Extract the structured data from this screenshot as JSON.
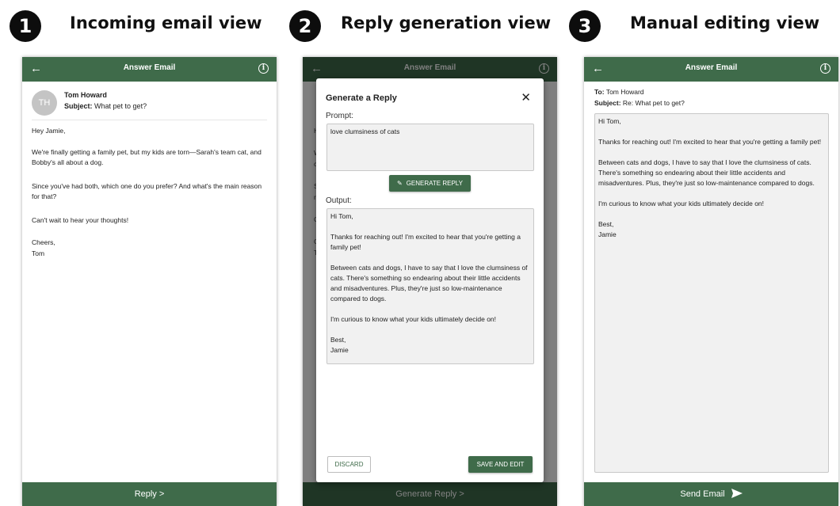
{
  "steps": [
    {
      "number": "1",
      "title": "Incoming email view"
    },
    {
      "number": "2",
      "title": "Reply generation view"
    },
    {
      "number": "3",
      "title": "Manual editing view"
    }
  ],
  "appbar": {
    "title": "Answer Email",
    "back_icon": "arrow-left-icon",
    "info_icon": "info-icon"
  },
  "colors": {
    "primary": "#3f6b4a",
    "badge": "#0d0d0d"
  },
  "incoming": {
    "avatar_initials": "TH",
    "sender": "Tom Howard",
    "subject_label": "Subject:",
    "subject": "What pet to get?",
    "body": [
      "Hey Jamie,",
      "We're finally getting a family pet, but my kids are torn—Sarah's team cat, and Bobby's all about a dog.",
      "Since you've had both, which one do you prefer? And what's the main reason for that?",
      "Can't wait to hear your thoughts!",
      "Cheers,",
      "Tom"
    ],
    "bottom_button": "Reply >"
  },
  "generate": {
    "dialog_title": "Generate a Reply",
    "prompt_label": "Prompt:",
    "prompt_value": "love clumsiness of cats",
    "generate_button": "GENERATE REPLY",
    "output_label": "Output:",
    "output": [
      "Hi Tom,",
      "Thanks for reaching out! I'm excited to hear that you're getting a family pet!",
      "Between cats and dogs, I have to say that I love the clumsiness of cats. There's something so endearing about their little accidents and misadventures. Plus, they're just so low-maintenance compared to dogs.",
      "I'm curious to know what your kids ultimately decide on!",
      "Best,",
      "Jamie"
    ],
    "discard_button": "DISCARD",
    "save_button": "SAVE AND EDIT",
    "bottom_button": "Generate Reply >"
  },
  "editing": {
    "to_label": "To:",
    "to_value": "Tom Howard",
    "subject_label": "Subject:",
    "subject_value": "Re: What pet to get?",
    "body": [
      "Hi Tom,",
      "Thanks for reaching out! I'm excited to hear that you're getting a family pet!",
      "Between cats and dogs, I have to say that I love the clumsiness of cats. There's something so endearing about their little accidents and misadventures. Plus, they're just so low-maintenance compared to dogs.",
      "I'm curious to know what your kids ultimately decide on!",
      "Best,",
      "Jamie"
    ],
    "send_button": "Send Email",
    "send_icon": "send-icon"
  }
}
